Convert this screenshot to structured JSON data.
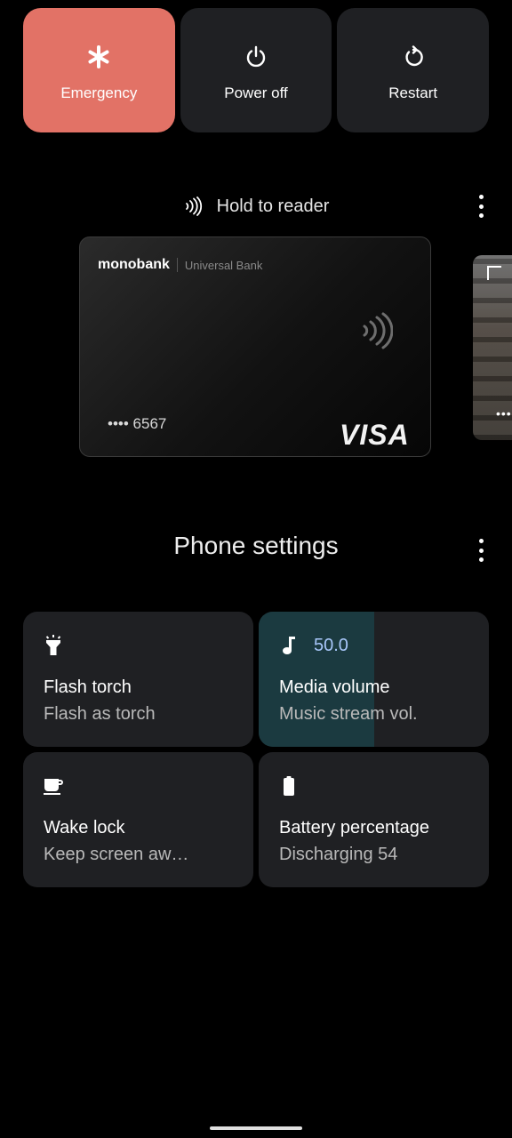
{
  "power_menu": {
    "emergency_label": "Emergency",
    "power_off_label": "Power off",
    "restart_label": "Restart",
    "emergency_color": "#e27266",
    "icons": [
      "asterisk-icon",
      "power-icon",
      "restart-icon"
    ]
  },
  "wallet": {
    "header": "Hold to reader",
    "card": {
      "bank_name": "monobank",
      "bank_subtitle": "Universal Bank",
      "masked_number": "•••• 6567",
      "network": "VISA"
    },
    "next_card_masked": "••••"
  },
  "settings": {
    "title": "Phone settings",
    "tiles": [
      {
        "icon": "flashlight-icon",
        "title": "Flash torch",
        "subtitle": "Flash as torch"
      },
      {
        "icon": "music-note-icon",
        "value": "50.0",
        "level_percent": 50,
        "title": "Media volume",
        "subtitle": "Music stream vol."
      },
      {
        "icon": "coffee-cup-icon",
        "title": "Wake lock",
        "subtitle": "Keep screen aw…"
      },
      {
        "icon": "battery-icon",
        "title": "Battery percentage",
        "subtitle": "Discharging 54"
      }
    ],
    "accent_color": "#a8c7fa",
    "volume_fill_color": "#1b3a40"
  }
}
